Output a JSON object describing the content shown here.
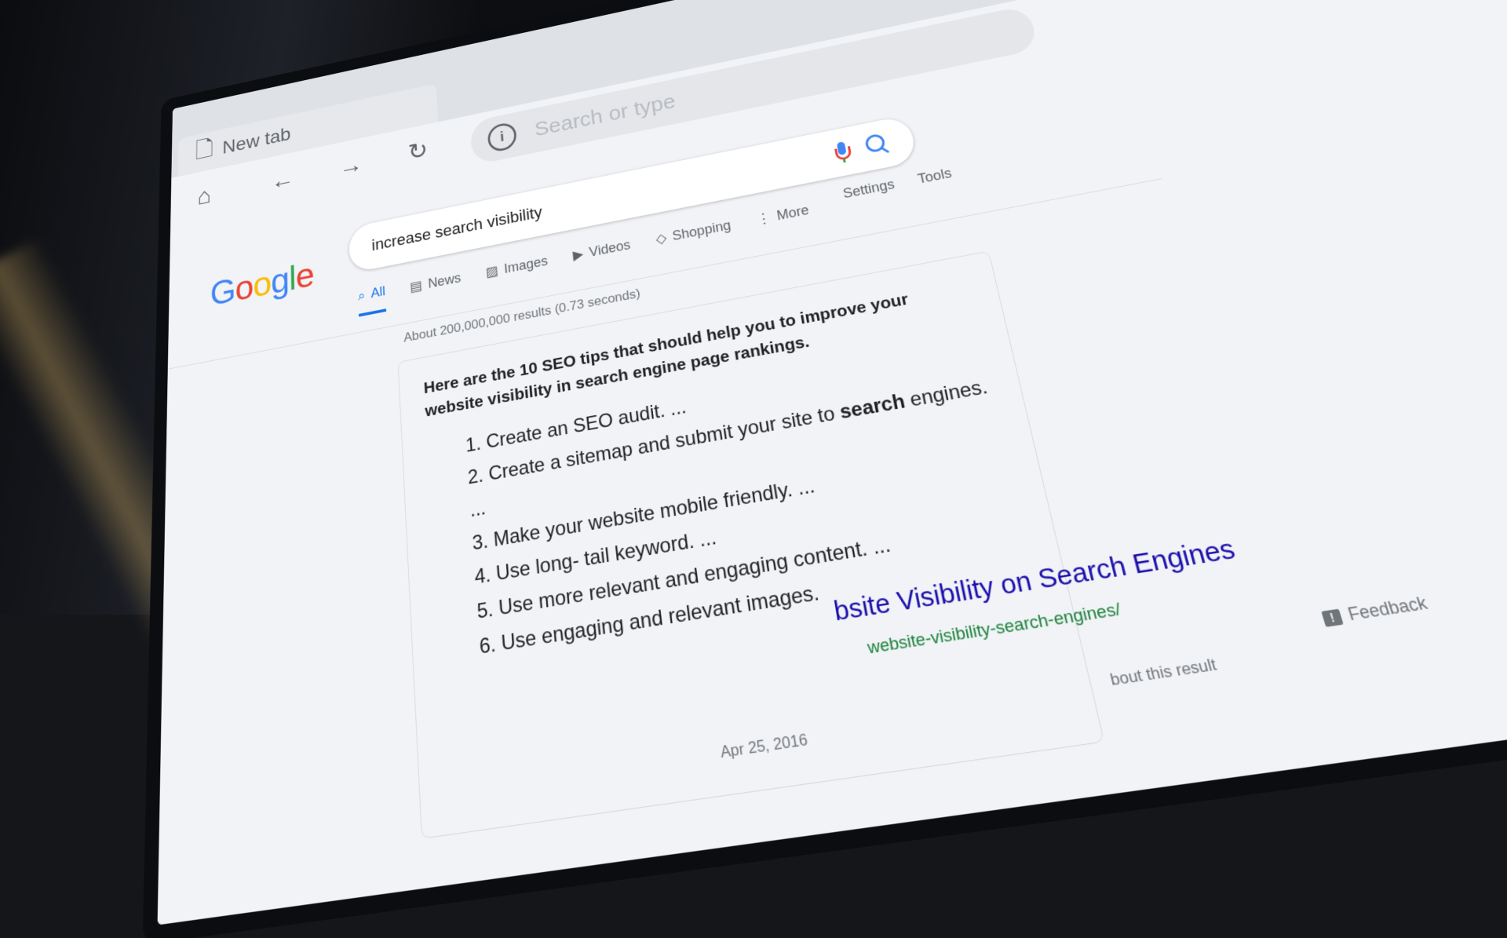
{
  "browser": {
    "tab_title": "New tab",
    "omnibox_placeholder": "Search or type"
  },
  "google": {
    "logo": [
      "G",
      "o",
      "o",
      "g",
      "l",
      "e"
    ],
    "logo_colors": [
      "#4285f4",
      "#ea4335",
      "#fbbc05",
      "#4285f4",
      "#34a853",
      "#ea4335"
    ],
    "query": "increase search visibility",
    "tabs": [
      {
        "label": "All",
        "icon": "search-icon",
        "active": true
      },
      {
        "label": "News",
        "icon": "news-icon",
        "active": false
      },
      {
        "label": "Images",
        "icon": "image-icon",
        "active": false
      },
      {
        "label": "Videos",
        "icon": "video-icon",
        "active": false
      },
      {
        "label": "Shopping",
        "icon": "tag-icon",
        "active": false
      },
      {
        "label": "More",
        "icon": "more-dots-icon",
        "active": false
      }
    ],
    "settings_label": "Settings",
    "tools_label": "Tools",
    "result_stats": "About 200,000,000 results (0.73 seconds)"
  },
  "snippet": {
    "heading": "Here are the 10 SEO tips that should help you to improve your website visibility in search engine page rankings.",
    "items": [
      {
        "prefix": "1. Create an SEO audit. ...",
        "bold": "",
        "suffix": ""
      },
      {
        "prefix": "2. Create a sitemap and submit your site to ",
        "bold": "search",
        "suffix": " engines. ..."
      },
      {
        "prefix": "3. Make your website mobile friendly. ...",
        "bold": "",
        "suffix": ""
      },
      {
        "prefix": "4. Use long- tail keyword. ...",
        "bold": "",
        "suffix": ""
      },
      {
        "prefix": "5. Use more relevant and engaging content. ...",
        "bold": "",
        "suffix": ""
      },
      {
        "prefix": "6. Use engaging and relevant images.",
        "bold": "",
        "suffix": ""
      }
    ],
    "date": "Apr 25, 2016",
    "result_title": "bsite Visibility on Search Engines",
    "result_url": "website-visibility-search-engines/",
    "about_text": "bout this result",
    "feedback_label": "Feedback"
  },
  "colors": {
    "accent": "#1a73e8",
    "link": "#1a0dab",
    "url_green": "#188038"
  }
}
